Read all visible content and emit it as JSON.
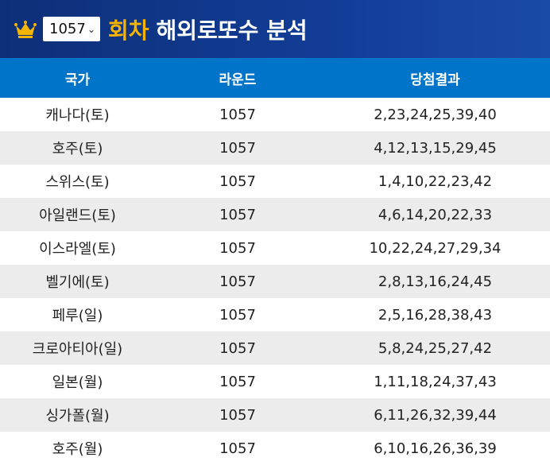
{
  "header": {
    "round_value": "1057",
    "title_accent": "회차",
    "title_main": "해외로또수 분석"
  },
  "table": {
    "columns": [
      "국가",
      "라운드",
      "당첨결과"
    ],
    "rows": [
      {
        "country": "캐나다(토)",
        "round": "1057",
        "result": "2,23,24,25,39,40"
      },
      {
        "country": "호주(토)",
        "round": "1057",
        "result": "4,12,13,15,29,45"
      },
      {
        "country": "스위스(토)",
        "round": "1057",
        "result": "1,4,10,22,23,42"
      },
      {
        "country": "아일랜드(토)",
        "round": "1057",
        "result": "4,6,14,20,22,33"
      },
      {
        "country": "이스라엘(토)",
        "round": "1057",
        "result": "10,22,24,27,29,34"
      },
      {
        "country": "벨기에(토)",
        "round": "1057",
        "result": "2,8,13,16,24,45"
      },
      {
        "country": "페루(일)",
        "round": "1057",
        "result": "2,5,16,28,38,43"
      },
      {
        "country": "크로아티아(일)",
        "round": "1057",
        "result": "5,8,24,25,27,42"
      },
      {
        "country": "일본(월)",
        "round": "1057",
        "result": "1,11,18,24,37,43"
      },
      {
        "country": "싱가폴(월)",
        "round": "1057",
        "result": "6,11,26,32,39,44"
      },
      {
        "country": "호주(월)",
        "round": "1057",
        "result": "6,10,16,26,36,39"
      }
    ]
  },
  "colors": {
    "header_bg": "#123d97",
    "accent": "#f5b400",
    "colhead_bg": "#0074c8",
    "row_alt": "#ececec"
  },
  "icons": {
    "crown": "crown-icon",
    "dropdown": "chevron-down-icon"
  }
}
